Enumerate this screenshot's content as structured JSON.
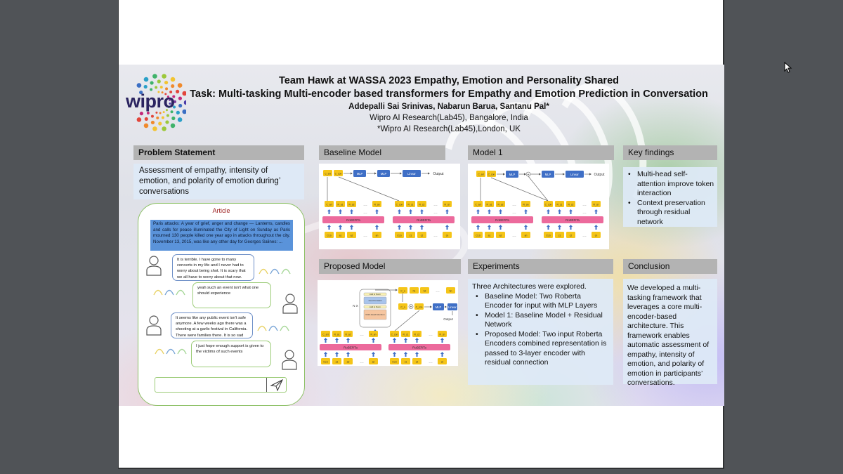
{
  "poster": {
    "logo_text": "wipro",
    "title_line1": "Team Hawk at WASSA 2023 Empathy, Emotion and Personality Shared",
    "title_line2": "Task: Multi-tasking Multi-encoder based transformers for Empathy and Emotion Prediction in Conversation",
    "authors": "Addepalli Sai Srinivas, Nabarun Barua, Santanu Pal*",
    "affiliation1": "Wipro AI Research(Lab45), Bangalore, India",
    "affiliation2": "*Wipro AI Research(Lab45),London, UK"
  },
  "problem": {
    "header": "Problem Statement",
    "text": "Assessment of empathy, intensity of emotion, and polarity of emotion during’ conversations"
  },
  "chat": {
    "article_title": "Article",
    "article_text": "Paris attacks: A year of grief, anger and change — Lanterns, candles and calls for peace illuminated the City of Light on Sunday as Paris mourned 130 people killed one year ago in attacks throughout the city. November 13, 2015, was like any other day for Georges Salines: ...",
    "messages": [
      {
        "side": "left",
        "text": "It is terrible. I have gone to many concerts in my life and I never had to worry about being shot. It is scary that we all have to worry about that now."
      },
      {
        "side": "right",
        "text": "yeah such an event isn't what one should experience"
      },
      {
        "side": "left",
        "text": "It seems like any public event isn't safe anymore. A few weeks ago there was a shooting at a garlic festival in California. There were families there. It is so sad"
      },
      {
        "side": "right",
        "text": "I just hope enough support is given to the victims of such events"
      }
    ],
    "input_value": "",
    "send_icon": "paper-plane-icon"
  },
  "baseline": {
    "header": "Baseline Model",
    "top_tokens": [
      "C_art",
      "C_con"
    ],
    "blocks": [
      "MLP",
      "MLP",
      "Linear"
    ],
    "output_label": "Output",
    "encoder_label": "RoBERTa",
    "left_out_tokens": [
      "C_art",
      "R_a1",
      "R_a2",
      "...",
      "R_an"
    ],
    "right_out_tokens": [
      "C_con",
      "R_c1",
      "R_c2",
      "...",
      "R_cn"
    ],
    "left_in_tokens": [
      "CLS",
      "a1",
      "a2",
      "...",
      "an"
    ],
    "right_in_tokens": [
      "CLS",
      "c1",
      "c2",
      "...",
      "cn"
    ]
  },
  "model1": {
    "header": "Model 1",
    "top_tokens": [
      "C_art",
      "C_con"
    ],
    "blocks": [
      "MLP",
      "MLP",
      "Linear"
    ],
    "plus_symbol": "+",
    "output_label": "Output",
    "encoder_label": "RoBERTa",
    "left_out_tokens": [
      "C_art",
      "R_a1",
      "R_a2",
      "...",
      "R_an"
    ],
    "right_out_tokens": [
      "C_con",
      "R_c1",
      "R_c2",
      "...",
      "R_cn"
    ],
    "left_in_tokens": [
      "CLS",
      "a1",
      "a2",
      "...",
      "an"
    ],
    "right_in_tokens": [
      "CLS",
      "c1",
      "c2",
      "...",
      "cn"
    ]
  },
  "proposed": {
    "header": "Proposed Model",
    "nx_label": "N X",
    "encoder_layers": [
      "Add & Norm",
      "Feed Forward",
      "Add & Norm",
      "Multi-Head Attention"
    ],
    "top_tokens": [
      "C_o",
      "h1",
      "h2",
      "...",
      "hn"
    ],
    "mid_tokens": [
      "C_o",
      "C_con"
    ],
    "blocks": [
      "MLP",
      "Linear"
    ],
    "plus_symbol": "+",
    "output_label": "Output",
    "encoder_label": "RoBERTa",
    "left_out_tokens": [
      "C_art",
      "R_a1",
      "R_a2",
      "...",
      "R_an"
    ],
    "right_out_tokens": [
      "C_con",
      "R_c1",
      "R_c2",
      "...",
      "R_cn"
    ],
    "left_in_tokens": [
      "CLS",
      "a1",
      "a2",
      "...",
      "an"
    ],
    "right_in_tokens": [
      "CLS",
      "c1",
      "c2",
      "...",
      "cn"
    ]
  },
  "key_findings": {
    "header": "Key findings",
    "items": [
      "Multi-head self-attention improve token interaction",
      "Context preservation through residual network"
    ]
  },
  "experiments": {
    "header": "Experiments",
    "intro": "Three Architectures were explored.",
    "items": [
      "Baseline Model: Two Roberta Encoder for input with MLP Layers",
      "Model 1: Baseline Model + Residual Network",
      "Proposed Model: Two input Roberta Encoders combined representation is passed to 3-layer encoder with residual connection"
    ]
  },
  "conclusion": {
    "header": "Conclusion",
    "text": "We developed a multi-tasking framework that leverages a core multi-encoder-based architecture. This framework enables automatic assessment of empathy, intensity of emotion, and polarity of emotion in participants’ conversations."
  },
  "colors": {
    "token": "#f5c518",
    "block": "#3f6fc6",
    "encoder": "#ec6a9c",
    "arrow": "#3f6fc6",
    "header_bg": "#b3b3b3",
    "box_bg": "#deeaf6",
    "chat_border": "#8cc065"
  }
}
